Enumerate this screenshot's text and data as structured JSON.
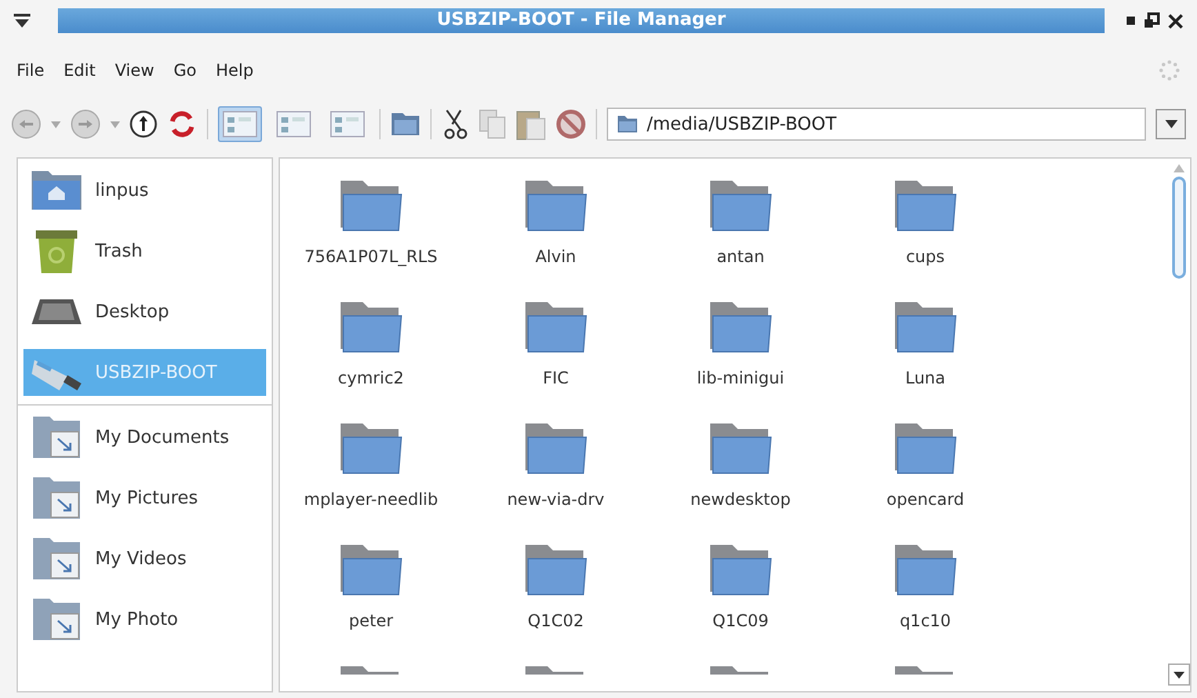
{
  "window": {
    "title": "USBZIP-BOOT - File Manager"
  },
  "menu": [
    "File",
    "Edit",
    "View",
    "Go",
    "Help"
  ],
  "toolbar": {
    "views": [
      {
        "selected": true
      },
      {
        "selected": false
      },
      {
        "selected": false
      }
    ],
    "location": "/media/USBZIP-BOOT"
  },
  "sidebar": {
    "items": [
      {
        "label": "linpus",
        "kind": "home",
        "selected": false
      },
      {
        "label": "Trash",
        "kind": "trash",
        "selected": false
      },
      {
        "label": "Desktop",
        "kind": "desktop",
        "selected": false
      },
      {
        "label": "USBZIP-BOOT",
        "kind": "usb",
        "selected": true
      },
      {
        "label": "My Documents",
        "kind": "link",
        "selected": false
      },
      {
        "label": "My Pictures",
        "kind": "link",
        "selected": false
      },
      {
        "label": "My Videos",
        "kind": "link",
        "selected": false
      },
      {
        "label": "My Photo",
        "kind": "link",
        "selected": false
      }
    ]
  },
  "files": [
    "756A1P07L_RLS",
    "Alvin",
    "antan",
    "cups",
    "cymric2",
    "FIC",
    "lib-minigui",
    "Luna",
    "mplayer-needlib",
    "new-via-drv",
    "newdesktop",
    "opencard",
    "peter",
    "Q1C02",
    "Q1C09",
    "q1c10"
  ]
}
